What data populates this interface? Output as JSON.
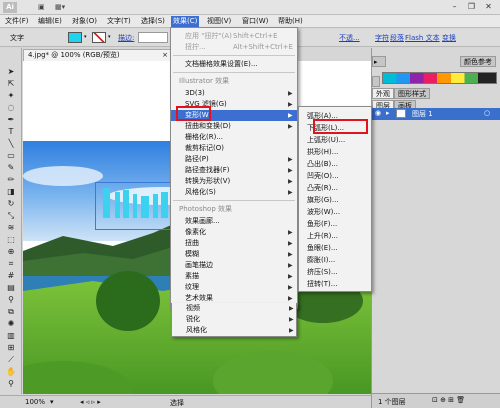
{
  "app": {
    "logo": "Ai",
    "minimize": "–",
    "restore": "❐",
    "close": "✕"
  },
  "menubar": [
    "文件(F)",
    "编辑(E)",
    "对象(O)",
    "文字(T)",
    "选择(S)",
    "效果(C)",
    "视图(V)",
    "窗口(W)",
    "帮助(H)"
  ],
  "controlbar": {
    "mode_label": "文字",
    "stroke_link": "描边:",
    "not_transparent": "不透...",
    "char_link": "字符",
    "paragraph_link": "段落",
    "flash_text": "Flash 文本",
    "transform_link": "变换",
    "fill_color": "#22d3ee",
    "stroke_color": "#ffffff"
  },
  "document": {
    "tab_title": "4.jpg* @ 100% (RGB/预览)",
    "tab_close": "×",
    "sample_text_color": "#3bd1ef"
  },
  "statusbar": {
    "zoom": "100%",
    "tool": "选择"
  },
  "effect_menu": {
    "items": [
      {
        "label": "应用 \"扭拧\"(A)",
        "shortcut": "Shift+Ctrl+E",
        "dim": true
      },
      {
        "label": "扭拧...",
        "shortcut": "Alt+Shift+Ctrl+E",
        "dim": true
      },
      {
        "label": "文档栅格效果设置(E)..."
      },
      {
        "label": "Illustrator 效果",
        "section": true
      },
      {
        "label": "3D(3)"
      },
      {
        "label": "SVG 滤镜(G)"
      },
      {
        "label": "变形(W)",
        "highlight": true
      },
      {
        "label": "扭曲和变换(D)"
      },
      {
        "label": "栅格化(R)..."
      },
      {
        "label": "裁剪标记(O)"
      },
      {
        "label": "路径(P)"
      },
      {
        "label": "路径查找器(F)"
      },
      {
        "label": "转换为形状(V)"
      },
      {
        "label": "风格化(S)"
      },
      {
        "label": "Photoshop 效果",
        "section": true
      },
      {
        "label": "效果画廊..."
      },
      {
        "label": "像素化"
      },
      {
        "label": "扭曲"
      },
      {
        "label": "模糊"
      },
      {
        "label": "画笔描边"
      },
      {
        "label": "素描"
      },
      {
        "label": "纹理"
      },
      {
        "label": "艺术效果"
      },
      {
        "label": "视频"
      },
      {
        "label": "锐化"
      },
      {
        "label": "风格化"
      }
    ]
  },
  "warp_menu": {
    "items": [
      "弧形(A)...",
      "下弧形(L)...",
      "上弧形(U)...",
      "拱形(H)...",
      "凸出(B)...",
      "凹壳(O)...",
      "凸壳(R)...",
      "旗形(G)...",
      "波形(W)...",
      "鱼形(F)...",
      "上升(R)...",
      "鱼眼(E)...",
      "膨胀(I)...",
      "挤压(S)...",
      "扭转(T)..."
    ],
    "highlighted_index": 1
  },
  "panels": {
    "tab_appearance": "外观",
    "tab_graphic_styles": "图形样式",
    "tab_align": "对齐",
    "tab_pathfinder": "路径查找",
    "tab_color_ref": "颜色参考",
    "tab_layers": "图层",
    "tab_artboards": "画板",
    "layer_name": "图层 1",
    "layers_count": "1 个图层"
  }
}
